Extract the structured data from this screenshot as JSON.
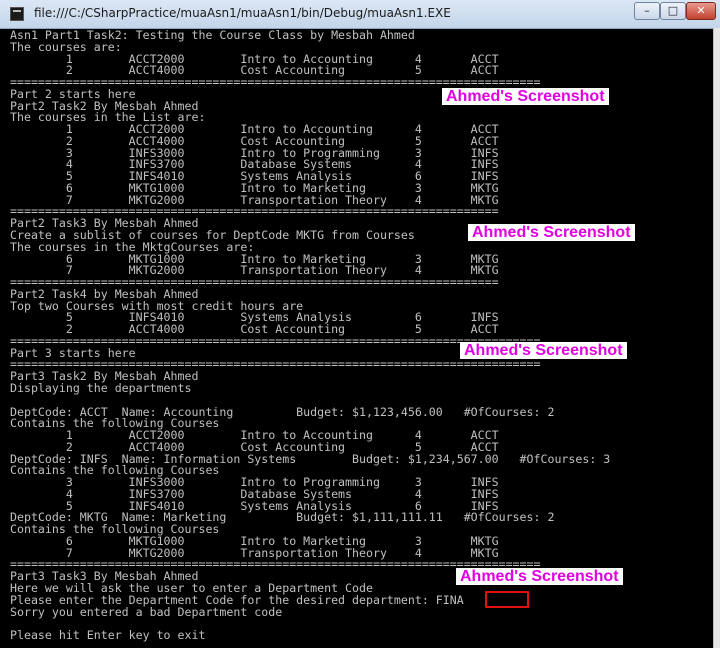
{
  "window": {
    "title": "file:///C:/CSharpPractice/muaAsn1/muaAsn1/bin/Debug/muaAsn1.EXE",
    "buttons": {
      "minimize": "–",
      "maximize": "□",
      "close": "✕"
    }
  },
  "console_lines": [
    "Asn1 Part1 Task2: Testing the Course Class by Mesbah Ahmed",
    "The courses are:",
    "        1        ACCT2000        Intro to Accounting      4       ACCT",
    "        2        ACCT4000        Cost Accounting          5       ACCT",
    "============================================================================",
    "Part 2 starts here",
    "Part2 Task2 By Mesbah Ahmed",
    "The courses in the List are:",
    "        1        ACCT2000        Intro to Accounting      4       ACCT",
    "        2        ACCT4000        Cost Accounting          5       ACCT",
    "        3        INFS3000        Intro to Programming     3       INFS",
    "        4        INFS3700        Database Systems         4       INFS",
    "        5        INFS4010        Systems Analysis         6       INFS",
    "        6        MKTG1000        Intro to Marketing       3       MKTG",
    "        7        MKTG2000        Transportation Theory    4       MKTG",
    "======================================================================",
    "Part2 Task3 By Mesbah Ahmed",
    "Create a sublist of courses for DeptCode MKTG from Courses",
    "The courses in the MktgCourses are:",
    "        6        MKTG1000        Intro to Marketing       3       MKTG",
    "        7        MKTG2000        Transportation Theory    4       MKTG",
    "======================================================================",
    "Part2 Task4 by Mesbah Ahmed",
    "Top two Courses with most credit hours are",
    "        5        INFS4010        Systems Analysis         6       INFS",
    "        2        ACCT4000        Cost Accounting          5       ACCT",
    "============================================================================",
    "Part 3 starts here",
    "============================================================================",
    "Part3 Task2 By Mesbah Ahmed",
    "Displaying the departments",
    "",
    "DeptCode: ACCT  Name: Accounting         Budget: $1,123,456.00   #OfCourses: 2",
    "Contains the following Courses",
    "        1        ACCT2000        Intro to Accounting      4       ACCT",
    "        2        ACCT4000        Cost Accounting          5       ACCT",
    "DeptCode: INFS  Name: Information Systems        Budget: $1,234,567.00   #OfCourses: 3",
    "Contains the following Courses",
    "        3        INFS3000        Intro to Programming     3       INFS",
    "        4        INFS3700        Database Systems         4       INFS",
    "        5        INFS4010        Systems Analysis         6       INFS",
    "DeptCode: MKTG  Name: Marketing          Budget: $1,111,111.11   #OfCourses: 2",
    "Contains the following Courses",
    "        6        MKTG1000        Intro to Marketing       3       MKTG",
    "        7        MKTG2000        Transportation Theory    4       MKTG",
    "============================================================================",
    "Part3 Task3 By Mesbah Ahmed",
    "Here we will ask the user to enter a Department Code",
    "Please enter the Department Code for the desired department: FINA",
    "Sorry you entered a bad Department code",
    "",
    "Please hit Enter key to exit"
  ],
  "watermarks": [
    "Ahmed's Screenshot",
    "Ahmed's Screenshot",
    "Ahmed's Screenshot",
    "Ahmed's Screenshot"
  ],
  "entered_code": "FINA"
}
